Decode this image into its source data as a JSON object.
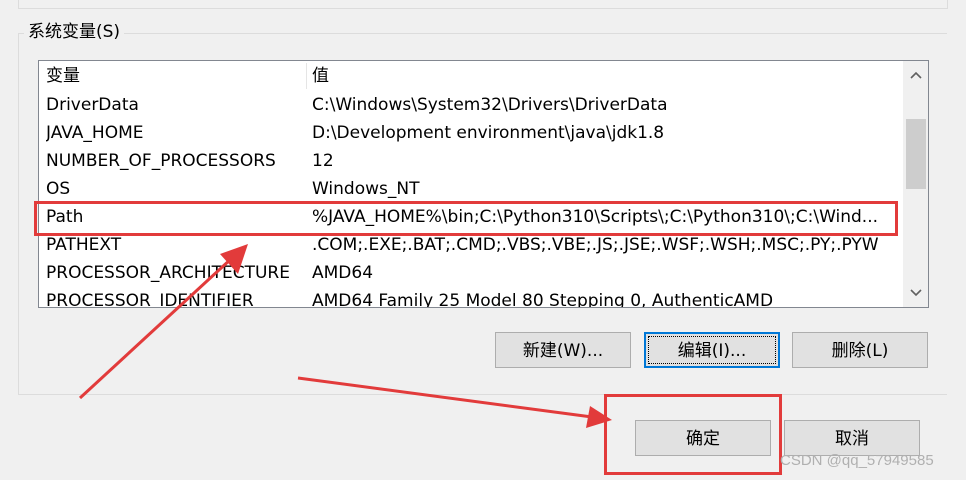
{
  "group": {
    "title": "系统变量(S)"
  },
  "table": {
    "headers": {
      "name": "变量",
      "value": "值"
    },
    "rows": [
      {
        "name": "DriverData",
        "value": "C:\\Windows\\System32\\Drivers\\DriverData"
      },
      {
        "name": "JAVA_HOME",
        "value": "D:\\Development environment\\java\\jdk1.8"
      },
      {
        "name": "NUMBER_OF_PROCESSORS",
        "value": "12"
      },
      {
        "name": "OS",
        "value": "Windows_NT"
      },
      {
        "name": "Path",
        "value": "%JAVA_HOME%\\bin;C:\\Python310\\Scripts\\;C:\\Python310\\;C:\\Wind..."
      },
      {
        "name": "PATHEXT",
        "value": ".COM;.EXE;.BAT;.CMD;.VBS;.VBE;.JS;.JSE;.WSF;.WSH;.MSC;.PY;.PYW"
      },
      {
        "name": "PROCESSOR_ARCHITECTURE",
        "value": "AMD64"
      },
      {
        "name": "PROCESSOR_IDENTIFIER",
        "value": "AMD64 Family 25 Model 80 Stepping 0, AuthenticAMD"
      }
    ]
  },
  "buttons": {
    "new": "新建(W)...",
    "edit": "编辑(I)...",
    "delete": "删除(L)",
    "ok": "确定",
    "cancel": "取消"
  },
  "watermark": "CSDN @qq_57949585",
  "colors": {
    "annotation": "#e23b3b",
    "focus": "#0078d7"
  }
}
